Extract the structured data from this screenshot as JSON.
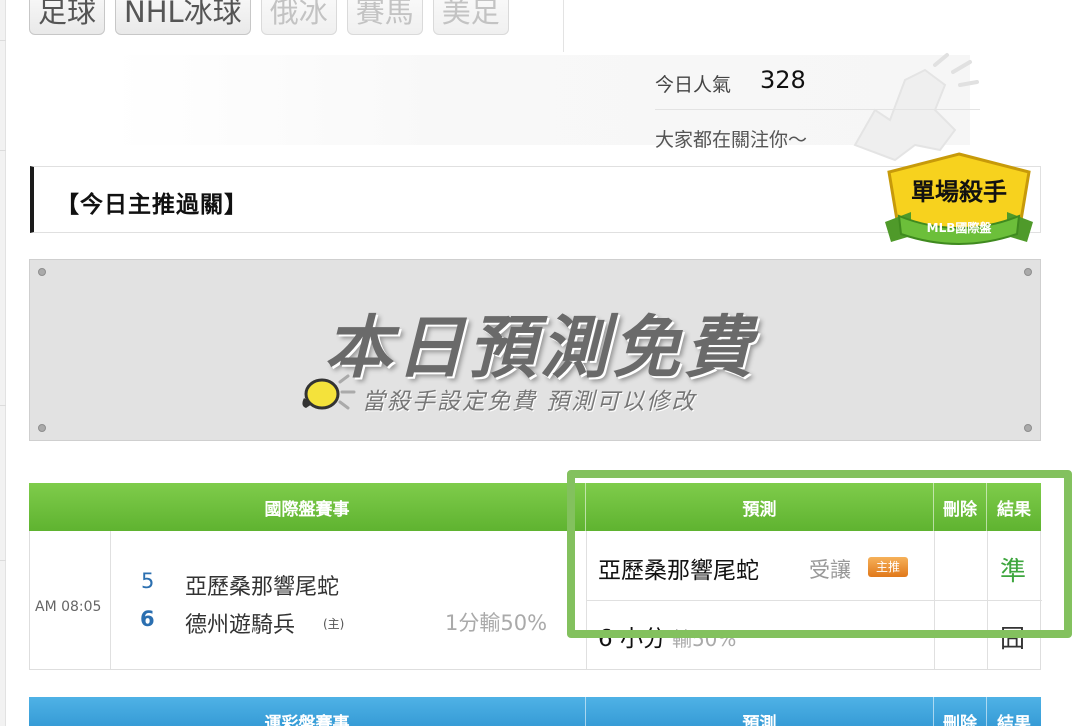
{
  "sport_tabs": [
    {
      "label": "足球",
      "active": true
    },
    {
      "label": "NHL冰球",
      "active": true
    },
    {
      "label": "俄冰",
      "active": false
    },
    {
      "label": "賽馬",
      "active": false
    },
    {
      "label": "美足",
      "active": false
    }
  ],
  "popularity": {
    "label": "今日人氣",
    "value": "328",
    "message": "大家都在關注你～"
  },
  "section": {
    "title": "【今日主推過關】",
    "badge_title": "單場殺手",
    "badge_subtitle": "MLB國際盤"
  },
  "banner": {
    "title": "本日預測免費",
    "subtitle": "當殺手設定免費  預測可以修改"
  },
  "international_table": {
    "headers": [
      "國際盤賽事",
      "預測",
      "刪除",
      "結果"
    ],
    "game": {
      "time": "AM 08:05",
      "away_number": "5",
      "away_team": "亞歷桑那響尾蛇",
      "home_number": "6",
      "home_team": "德州遊騎兵",
      "home_marker": "(主)",
      "handicap": "1分輸50%"
    },
    "predictions": [
      {
        "pick": "亞歷桑那響尾蛇",
        "type": "受讓",
        "tag": "主推",
        "result": "準"
      },
      {
        "pick": "6 小分",
        "type": "輸50%",
        "result": "囧"
      }
    ]
  },
  "lottery_table": {
    "headers": [
      "運彩盤賽事",
      "預測",
      "刪除",
      "結果"
    ]
  },
  "colors": {
    "green_header": "#5fb330",
    "blue_header": "#2d93d0",
    "highlight": "#83c15e",
    "result_win": "#3ea63e",
    "tag_orange": "#e0781a"
  }
}
